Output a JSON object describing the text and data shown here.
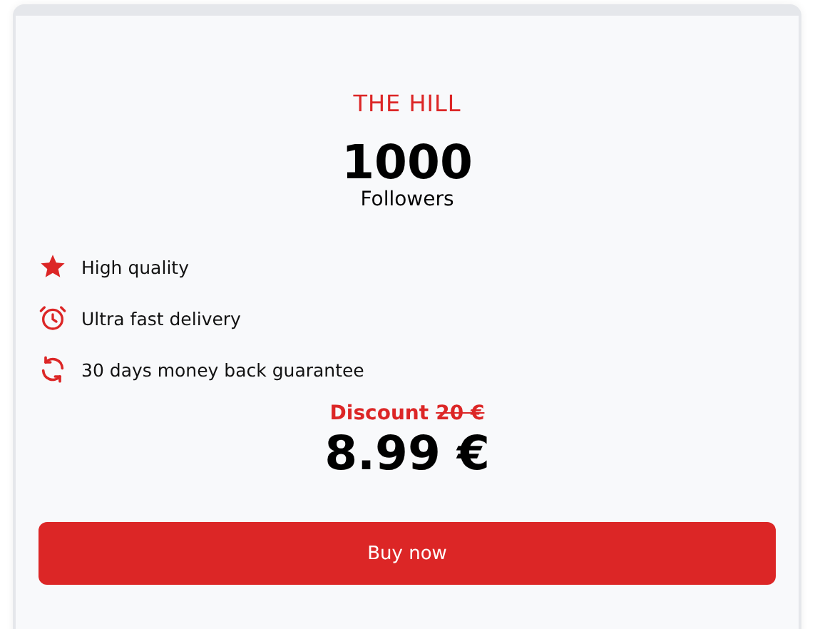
{
  "plan": {
    "title": "THE HILL",
    "amount": "1000",
    "unit": "Followers",
    "features": [
      {
        "kind": "star",
        "text": "High quality"
      },
      {
        "kind": "alarm",
        "text": "Ultra fast delivery"
      },
      {
        "kind": "refresh",
        "text": "30 days money back guarantee"
      }
    ],
    "discount_label": "Discount",
    "old_price": "20 €",
    "price": "8.99 €",
    "button": "Buy now"
  }
}
